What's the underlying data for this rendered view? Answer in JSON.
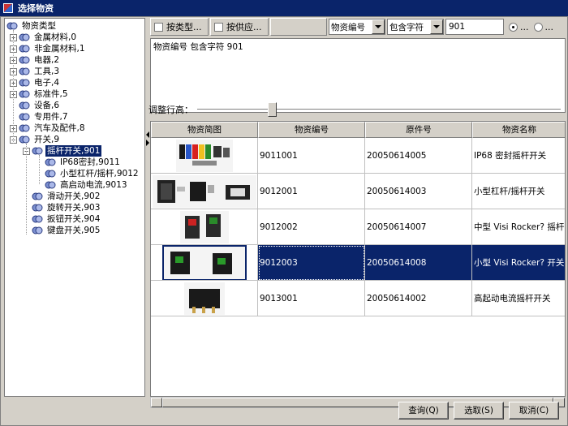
{
  "window": {
    "title": "选择物资"
  },
  "tree": {
    "root": "物资类型",
    "items": [
      {
        "label": "金属材料,0",
        "expander": "+"
      },
      {
        "label": "非金属材料,1",
        "expander": "+"
      },
      {
        "label": "电器,2",
        "expander": "+"
      },
      {
        "label": "工具,3",
        "expander": "+"
      },
      {
        "label": "电子,4",
        "expander": "+"
      },
      {
        "label": "标准件,5",
        "expander": "+"
      },
      {
        "label": "设备,6",
        "expander": ""
      },
      {
        "label": "专用件,7",
        "expander": ""
      },
      {
        "label": "汽车及配件,8",
        "expander": "+"
      },
      {
        "label": "开关,9",
        "expander": "-"
      },
      {
        "label": "摇杆开关,901",
        "expander": "-",
        "selected": true
      },
      {
        "label": "IP68密封,9011",
        "expander": ""
      },
      {
        "label": "小型杠杆/摇杆,9012",
        "expander": ""
      },
      {
        "label": "高启动电流,9013",
        "expander": ""
      },
      {
        "label": "滑动开关,902",
        "expander": ""
      },
      {
        "label": "旋转开关,903",
        "expander": ""
      },
      {
        "label": "扳钮开关,904",
        "expander": ""
      },
      {
        "label": "键盘开关,905",
        "expander": ""
      }
    ]
  },
  "toolbar": {
    "by_type": "按类型...",
    "by_supplier": "按供应...",
    "field_select": "物资编号",
    "op_select": "包含字符",
    "search_value": "901",
    "radio1": "...",
    "radio2": "..."
  },
  "condition": {
    "text": "物资编号  包含字符  901"
  },
  "rowheight": {
    "label": "调整行高：",
    "level": 0.2
  },
  "table": {
    "columns": [
      "物资简图",
      "物资编号",
      "原件号",
      "物资名称"
    ],
    "rows": [
      {
        "code": "9011001",
        "part": "20050614005",
        "name": "IP68 密封摇杆开关"
      },
      {
        "code": "9012001",
        "part": "20050614003",
        "name": "小型杠杆/摇杆开关"
      },
      {
        "code": "9012002",
        "part": "20050614007",
        "name": "中型 Visi Rocker? 摇杆开"
      },
      {
        "code": "9012003",
        "part": "20050614008",
        "name": "小型 Visi Rocker? 开关",
        "selected": true
      },
      {
        "code": "9013001",
        "part": "20050614002",
        "name": "高起动电流摇杆开关"
      }
    ]
  },
  "buttons": {
    "query": "查询(Q)",
    "select": "选取(S)",
    "cancel": "取消(C)"
  },
  "colors": {
    "selection": "#0a246a",
    "face": "#d4d0c8"
  }
}
